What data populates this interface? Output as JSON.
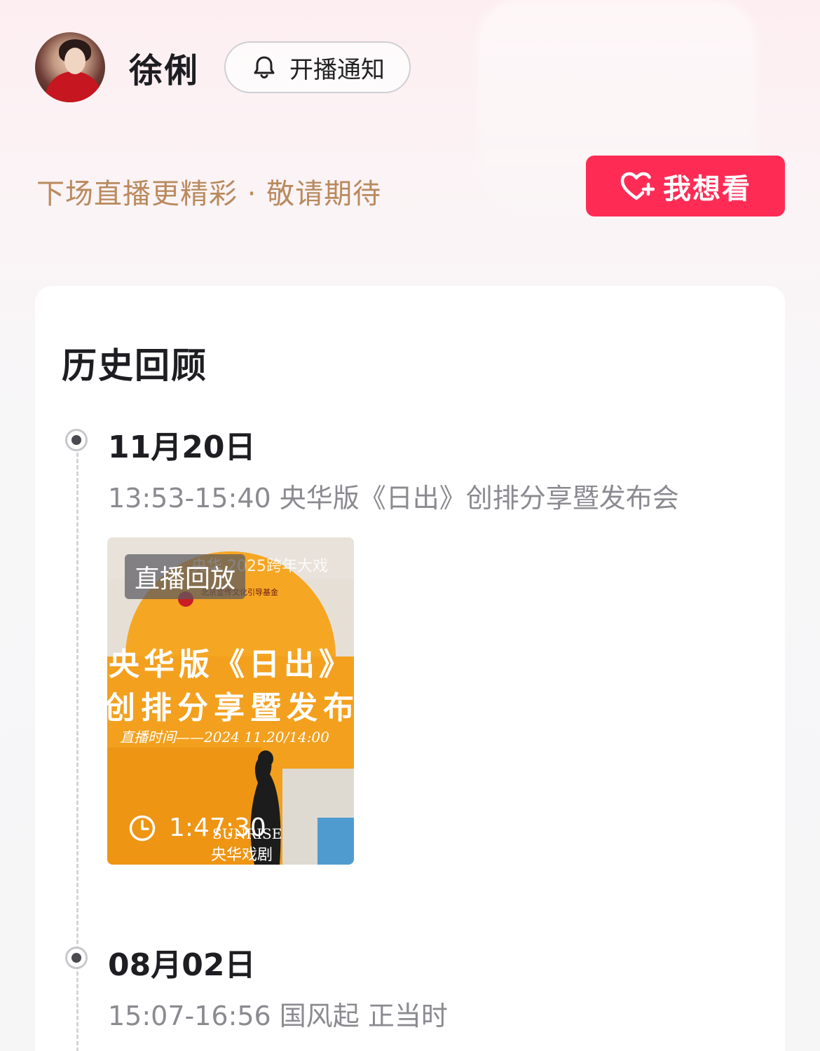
{
  "profile": {
    "name": "徐俐",
    "notify_label": "开播通知"
  },
  "promo": {
    "tagline": "下场直播更精彩 · 敬请期待",
    "want_label": "我想看"
  },
  "history": {
    "title": "历史回顾",
    "entries": [
      {
        "date": "11月20日",
        "desc": "13:53-15:40 央华版《日出》创排分享暨发布会",
        "thumbnail": {
          "badge": "直播回放",
          "duration": "1:47:30",
          "poster_line1": "央华版《日出》",
          "poster_line2": "创排分享暨发布",
          "poster_line3": "直播时间——2024 11.20/14:00",
          "poster_top": "央华 2025跨年大戏",
          "poster_en": "SUNRISE",
          "poster_brand": "央华戏剧"
        }
      },
      {
        "date": "08月02日",
        "desc": "15:07-16:56 国风起 正当时"
      }
    ]
  },
  "colors": {
    "accent": "#fe2c55",
    "tagline": "#b98a5e",
    "muted_text": "#8a8a90"
  }
}
